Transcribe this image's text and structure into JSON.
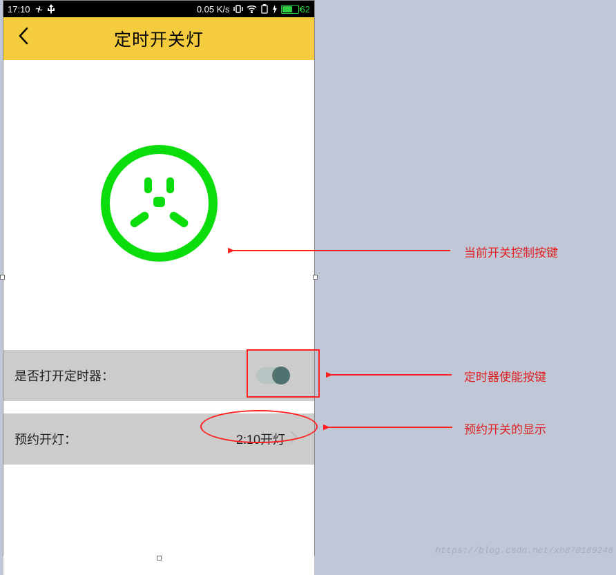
{
  "status_bar": {
    "time": "17:10",
    "net_speed": "0.05 K/s",
    "battery_percent": "62"
  },
  "header": {
    "title": "定时开关灯"
  },
  "timer_row": {
    "label": "是否打开定时器："
  },
  "schedule_row": {
    "label": "预约开灯：",
    "value": "2:10开灯"
  },
  "annotations": {
    "socket": "当前开关控制按键",
    "toggle": "定时器使能按键",
    "schedule": "预约开关的显示"
  },
  "watermark": "https://blog.csdn.net/xh870189248"
}
